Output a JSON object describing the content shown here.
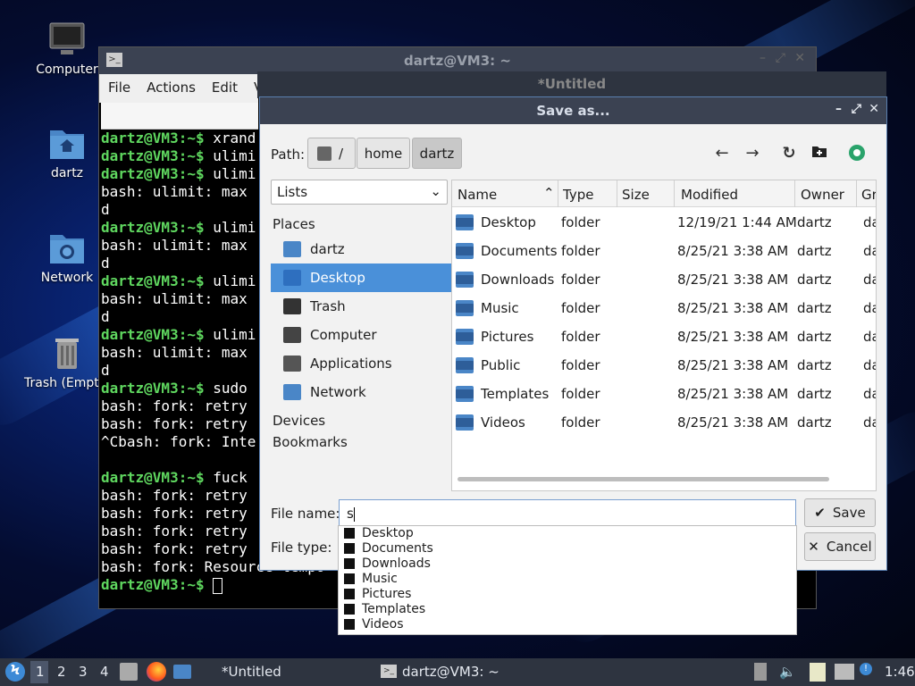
{
  "desktop": {
    "icons": [
      {
        "label": "Computer"
      },
      {
        "label": "dartz"
      },
      {
        "label": "Network"
      },
      {
        "label": "Trash (Empty)"
      }
    ]
  },
  "terminal": {
    "title": "dartz@VM3: ~",
    "menu": [
      "File",
      "Actions",
      "Edit",
      "V"
    ],
    "lines": [
      {
        "p": "dartz@VM3:~$ ",
        "t": "xrand"
      },
      {
        "p": "dartz@VM3:~$ ",
        "t": "ulimi"
      },
      {
        "p": "dartz@VM3:~$ ",
        "t": "ulimi"
      },
      {
        "p": "",
        "t": "bash: ulimit: max"
      },
      {
        "p": "",
        "t": "d"
      },
      {
        "p": "dartz@VM3:~$ ",
        "t": "ulimi"
      },
      {
        "p": "",
        "t": "bash: ulimit: max"
      },
      {
        "p": "",
        "t": "d"
      },
      {
        "p": "dartz@VM3:~$ ",
        "t": "ulimi"
      },
      {
        "p": "",
        "t": "bash: ulimit: max"
      },
      {
        "p": "",
        "t": "d"
      },
      {
        "p": "dartz@VM3:~$ ",
        "t": "ulimi"
      },
      {
        "p": "",
        "t": "bash: ulimit: max"
      },
      {
        "p": "",
        "t": "d"
      },
      {
        "p": "dartz@VM3:~$ ",
        "t": "sudo"
      },
      {
        "p": "",
        "t": "bash: fork: retry"
      },
      {
        "p": "",
        "t": "bash: fork: retry"
      },
      {
        "p": "",
        "t": "^Cbash: fork: Inte"
      },
      {
        "p": "",
        "t": ""
      },
      {
        "p": "dartz@VM3:~$ ",
        "t": "fuck"
      },
      {
        "p": "",
        "t": "bash: fork: retry"
      },
      {
        "p": "",
        "t": "bash: fork: retry"
      },
      {
        "p": "",
        "t": "bash: fork: retry"
      },
      {
        "p": "",
        "t": "bash: fork: retry"
      },
      {
        "p": "",
        "t": "bash: fork: Resource tempo"
      },
      {
        "p": "dartz@VM3:~$ ",
        "t": ""
      }
    ]
  },
  "untitled_window": {
    "title": "*Untitled"
  },
  "dialog": {
    "title": "Save as...",
    "path_label": "Path:",
    "path": [
      "/",
      "home",
      "dartz"
    ],
    "places_combo": "Lists",
    "places_header": "Places",
    "places": [
      {
        "label": "dartz",
        "color": "#4a86c7"
      },
      {
        "label": "Desktop",
        "color": "#2e6fbf"
      },
      {
        "label": "Trash",
        "color": "#333333"
      },
      {
        "label": "Computer",
        "color": "#444444"
      },
      {
        "label": "Applications",
        "color": "#555555"
      },
      {
        "label": "Network",
        "color": "#4a86c7"
      }
    ],
    "devices_header": "Devices",
    "bookmarks_header": "Bookmarks",
    "columns": [
      "Name",
      "Type",
      "Size",
      "Modified",
      "Owner",
      "Gr"
    ],
    "files": [
      {
        "name": "Desktop",
        "type": "folder",
        "modified": "12/19/21 1:44 AM",
        "owner": "dartz",
        "group": "da"
      },
      {
        "name": "Documents",
        "type": "folder",
        "modified": "8/25/21 3:38 AM",
        "owner": "dartz",
        "group": "da"
      },
      {
        "name": "Downloads",
        "type": "folder",
        "modified": "8/25/21 3:38 AM",
        "owner": "dartz",
        "group": "da"
      },
      {
        "name": "Music",
        "type": "folder",
        "modified": "8/25/21 3:38 AM",
        "owner": "dartz",
        "group": "da"
      },
      {
        "name": "Pictures",
        "type": "folder",
        "modified": "8/25/21 3:38 AM",
        "owner": "dartz",
        "group": "da"
      },
      {
        "name": "Public",
        "type": "folder",
        "modified": "8/25/21 3:38 AM",
        "owner": "dartz",
        "group": "da"
      },
      {
        "name": "Templates",
        "type": "folder",
        "modified": "8/25/21 3:38 AM",
        "owner": "dartz",
        "group": "da"
      },
      {
        "name": "Videos",
        "type": "folder",
        "modified": "8/25/21 3:38 AM",
        "owner": "dartz",
        "group": "da"
      }
    ],
    "file_name_label": "File name:",
    "file_name_value": "s",
    "file_type_label": "File type:",
    "save_label": "Save",
    "cancel_label": "Cancel",
    "completions": [
      "Desktop",
      "Documents",
      "Downloads",
      "Music",
      "Pictures",
      "Templates",
      "Videos"
    ]
  },
  "taskbar": {
    "workspaces": [
      "1",
      "2",
      "3",
      "4"
    ],
    "tasks": [
      "*Untitled",
      "dartz@VM3: ~"
    ],
    "clock": "1:46"
  }
}
